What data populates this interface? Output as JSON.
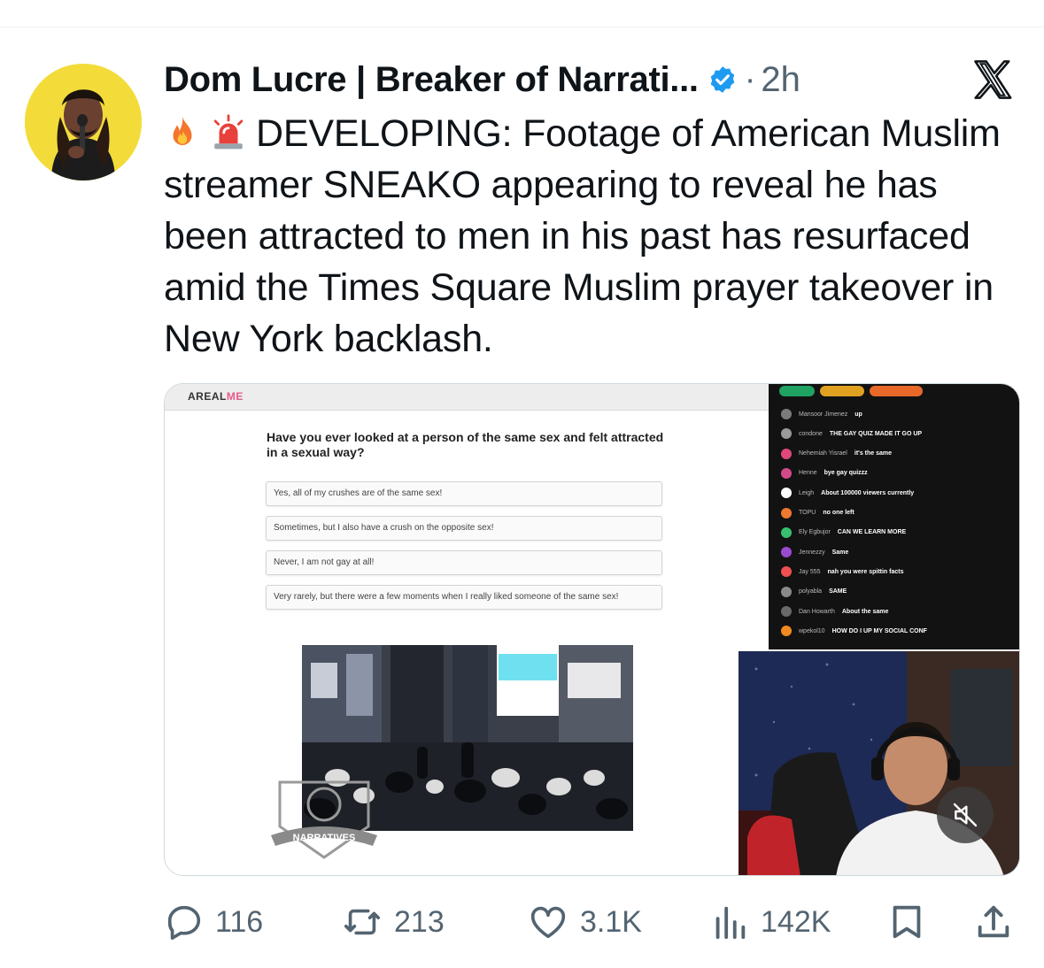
{
  "tweet": {
    "author_name": "Dom Lucre | Breaker of Narrati...",
    "separator": "·",
    "timestamp": "2h",
    "verified": true,
    "text": "DEVELOPING: Footage of American Muslim streamer SNEAKO appearing to reveal he has been attracted to men in his past has resurfaced amid the Times Square Muslim prayer takeover in New York backlash.",
    "leading_emojis": [
      "fire-emoji",
      "siren-emoji"
    ]
  },
  "media": {
    "quiz": {
      "site_logo_prefix": "AREAL",
      "site_logo_suffix": "ME",
      "question": "Have you ever looked at a person of the same sex and felt attracted in a sexual way?",
      "options": [
        "Yes, all of my crushes are of the same sex!",
        "Sometimes, but I also have a crush on the opposite sex!",
        "Never, I am not gay at all!",
        "Very rarely, but there were a few moments when I really liked someone of the same sex!"
      ]
    },
    "chat": {
      "messages": [
        {
          "user": "Mansoor Jimenez",
          "text": "up",
          "color": "#7b7b7b"
        },
        {
          "user": "condone",
          "text": "THE GAY QUIZ MADE IT GO UP",
          "color": "#9a9a9a"
        },
        {
          "user": "Nehemiah Yisrael",
          "text": "it's the same",
          "color": "#e0487a"
        },
        {
          "user": "Henne",
          "text": "bye gay quizzz",
          "color": "#d24a8a"
        },
        {
          "user": "Leigh",
          "text": "About 100000 viewers currently",
          "color": "#ffffff"
        },
        {
          "user": "TOPU",
          "text": "no one left",
          "color": "#f07830"
        },
        {
          "user": "Ely Egbujor",
          "text": "CAN WE LEARN MORE",
          "color": "#38c070"
        },
        {
          "user": "Jennezzy",
          "text": "Same",
          "color": "#9a4ad0"
        },
        {
          "user": "Jay 555",
          "text": "nah you were spittin facts",
          "color": "#f05050"
        },
        {
          "user": "polyabla",
          "text": "SAME",
          "color": "#8a8a8a"
        },
        {
          "user": "Dan Howarth",
          "text": "About the same",
          "color": "#6a6a6a"
        },
        {
          "user": "wpekol10",
          "text": "HOW DO I UP MY SOCIAL CONF",
          "color": "#f08a20"
        }
      ]
    },
    "watermark_text": "NARRATIVES",
    "mute_icon": "speaker-muted-icon"
  },
  "actions": {
    "replies": "116",
    "reposts": "213",
    "likes": "3.1K",
    "views": "142K"
  },
  "colors": {
    "text_primary": "#0f1419",
    "text_secondary": "#536471",
    "verified_blue": "#1d9bf0",
    "avatar_bg": "#f3dc3a"
  }
}
